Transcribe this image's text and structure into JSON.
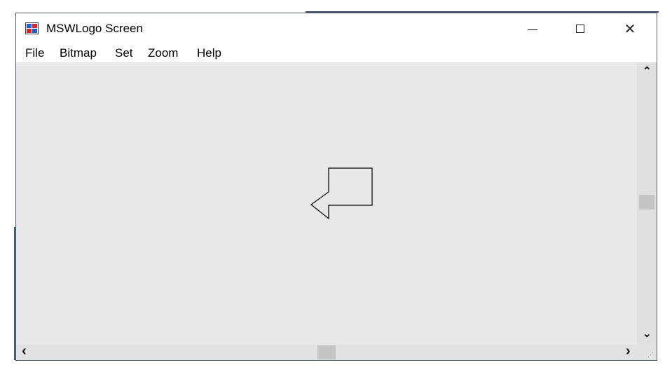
{
  "window": {
    "title": "MSWLogo Screen",
    "icon": "mswlogo-app-icon"
  },
  "controls": {
    "minimize_icon": "minimize-icon",
    "maximize_icon": "maximize-icon",
    "close_glyph": "✕"
  },
  "menu": {
    "items": [
      {
        "label": "File"
      },
      {
        "label": "Bitmap"
      },
      {
        "label": "Set"
      },
      {
        "label": "Zoom"
      },
      {
        "label": "Help"
      }
    ]
  },
  "scrollbars": {
    "up_arrow": "⌃",
    "down_arrow": "⌄",
    "left_arrow": "‹",
    "right_arrow": "›"
  },
  "colors": {
    "canvas_bg": "#e8e8e8",
    "turtle_stroke": "#000000"
  }
}
